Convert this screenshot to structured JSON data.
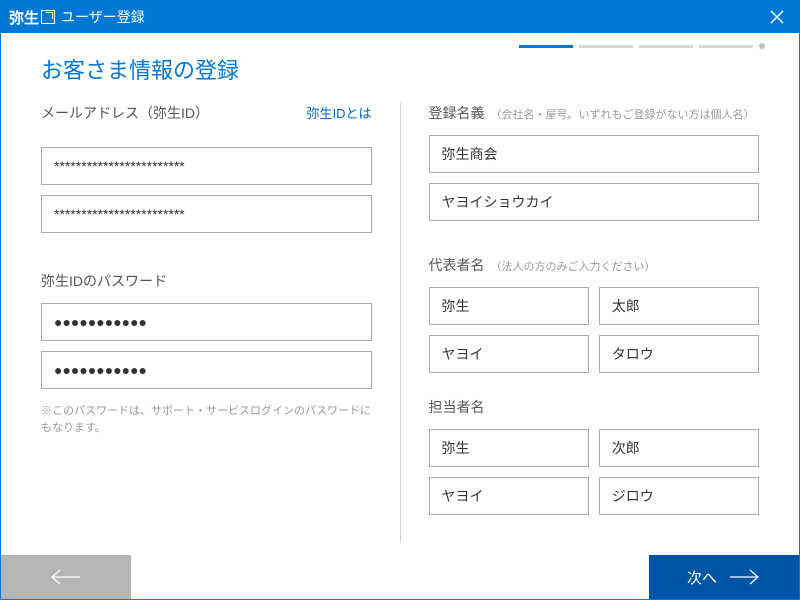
{
  "header": {
    "logo_text": "弥生",
    "title": "ユーザー登録"
  },
  "page_title": "お客さま情報の登録",
  "left": {
    "email": {
      "label": "メールアドレス（弥生ID）",
      "help_link": "弥生IDとは",
      "value1": "************************",
      "value2": "************************"
    },
    "password": {
      "label": "弥生IDのパスワード",
      "value1": "●●●●●●●●●●●",
      "value2": "●●●●●●●●●●●",
      "note": "※このパスワードは、サポート・サービスログインのパスワードにもなります。"
    }
  },
  "right": {
    "company": {
      "label": "登録名義",
      "hint": "（会社名・屋号。いずれもご登録がない方は個人名）",
      "name": "弥生商会",
      "kana": "ヤヨイショウカイ"
    },
    "representative": {
      "label": "代表者名",
      "hint": "（法人の方のみご入力ください）",
      "last": "弥生",
      "first": "太郎",
      "last_kana": "ヤヨイ",
      "first_kana": "タロウ"
    },
    "contact": {
      "label": "担当者名",
      "last": "弥生",
      "first": "次郎",
      "last_kana": "ヤヨイ",
      "first_kana": "ジロウ"
    }
  },
  "footer": {
    "next": "次へ"
  }
}
